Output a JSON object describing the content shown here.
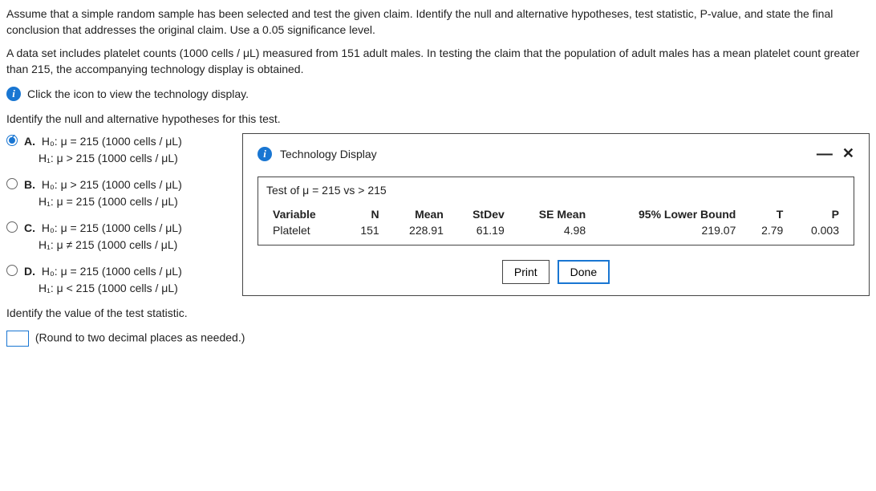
{
  "intro": {
    "p1": "Assume that a simple random sample has been selected and test the given claim. Identify the null and alternative hypotheses, test statistic, P-value, and state the final conclusion that addresses the original claim. Use a 0.05 significance level.",
    "p2": "A data set includes platelet counts (1000 cells / μL) measured from 151 adult males. In testing the claim that the population of adult males has a mean platelet count greater than 215, the accompanying technology display is obtained."
  },
  "info_link": "Click the icon to view the technology display.",
  "question1": "Identify the null and alternative hypotheses for this test.",
  "options": {
    "a": {
      "letter": "A.",
      "h0": "H₀: μ = 215 (1000 cells / μL)",
      "h1": "H₁: μ > 215 (1000 cells / μL)"
    },
    "b": {
      "letter": "B.",
      "h0": "H₀: μ > 215 (1000 cells / μL)",
      "h1": "H₁: μ = 215 (1000 cells / μL)"
    },
    "c": {
      "letter": "C.",
      "h0": "H₀: μ = 215 (1000 cells / μL)",
      "h1": "H₁: μ ≠ 215 (1000 cells / μL)"
    },
    "d": {
      "letter": "D.",
      "h0": "H₀: μ = 215 (1000 cells / μL)",
      "h1": "H₁: μ < 215 (1000 cells / μL)"
    }
  },
  "dialog": {
    "title": "Technology Display",
    "test_title": "Test of μ = 215 vs  > 215",
    "headers": {
      "variable": "Variable",
      "n": "N",
      "mean": "Mean",
      "stdev": "StDev",
      "semean": "SE Mean",
      "lower": "95% Lower Bound",
      "t": "T",
      "p": "P"
    },
    "row": {
      "variable": "Platelet",
      "n": "151",
      "mean": "228.91",
      "stdev": "61.19",
      "semean": "4.98",
      "lower": "219.07",
      "t": "2.79",
      "p": "0.003"
    },
    "print": "Print",
    "done": "Done"
  },
  "question2": "Identify the value of the test statistic.",
  "round_note": "(Round to two decimal places as needed.)",
  "chart_data": {
    "type": "table",
    "title": "Test of μ = 215 vs  > 215",
    "columns": [
      "Variable",
      "N",
      "Mean",
      "StDev",
      "SE Mean",
      "95% Lower Bound",
      "T",
      "P"
    ],
    "rows": [
      [
        "Platelet",
        151,
        228.91,
        61.19,
        4.98,
        219.07,
        2.79,
        0.003
      ]
    ]
  }
}
